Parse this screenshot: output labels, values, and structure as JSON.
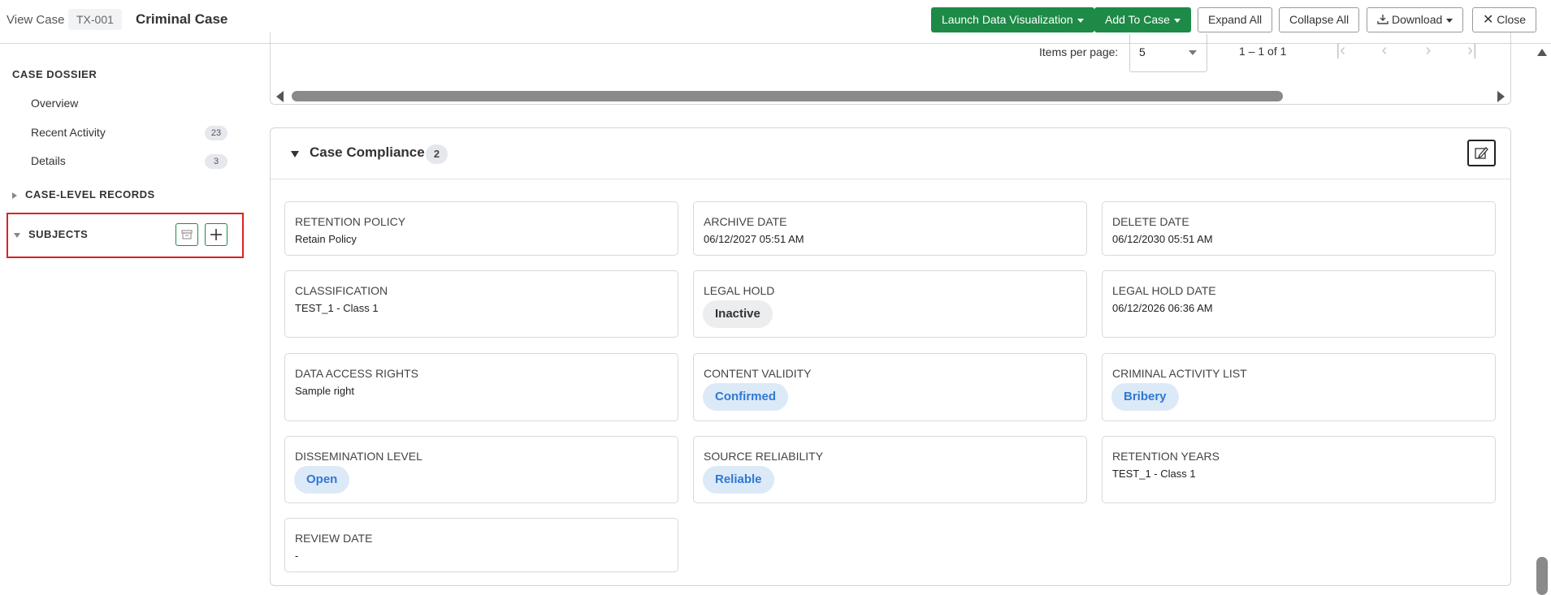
{
  "header": {
    "view_case": "View Case",
    "case_id": "TX-001",
    "case_title": "Criminal Case",
    "launch_viz": "Launch Data Visualization",
    "add_to_case": "Add To Case",
    "expand_all": "Expand All",
    "collapse_all": "Collapse All",
    "download": "Download",
    "close": "Close"
  },
  "sidebar": {
    "heading": "CASE DOSSIER",
    "items": [
      {
        "label": "Overview"
      },
      {
        "label": "Recent Activity",
        "badge": "23"
      },
      {
        "label": "Details",
        "badge": "3"
      }
    ],
    "case_level_records": "CASE-LEVEL RECORDS",
    "subjects": "SUBJECTS"
  },
  "table_footer": {
    "items_per_page_label": "Items per page:",
    "items_per_page_value": "5",
    "range": "1 – 1 of 1"
  },
  "compliance": {
    "title": "Case Compliance",
    "count": "2",
    "cards": [
      {
        "label": "RETENTION POLICY",
        "value": "Retain Policy"
      },
      {
        "label": "ARCHIVE DATE",
        "value": "06/12/2027 05:51 AM"
      },
      {
        "label": "DELETE DATE",
        "value": "06/12/2030 05:51 AM"
      },
      {
        "label": "CLASSIFICATION",
        "value": "TEST_1 - Class 1"
      },
      {
        "label": "LEGAL HOLD",
        "pill": "Inactive"
      },
      {
        "label": "LEGAL HOLD DATE",
        "value": "06/12/2026 06:36 AM"
      },
      {
        "label": "DATA ACCESS RIGHTS",
        "value": "Sample right"
      },
      {
        "label": "CONTENT VALIDITY",
        "pill": "Confirmed"
      },
      {
        "label": "CRIMINAL ACTIVITY LIST",
        "pill": "Bribery"
      },
      {
        "label": "DISSEMINATION LEVEL",
        "pill": "Open"
      },
      {
        "label": "SOURCE RELIABILITY",
        "pill": "Reliable"
      },
      {
        "label": "RETENTION YEARS",
        "value": "TEST_1 - Class 1"
      },
      {
        "label": "REVIEW DATE",
        "value": "-"
      }
    ]
  },
  "colors": {
    "primary_green": "#1d8a47",
    "highlight_red": "#e02020",
    "pill_blue_text": "#2f78d6",
    "pill_blue_bg": "#dce9f7"
  }
}
